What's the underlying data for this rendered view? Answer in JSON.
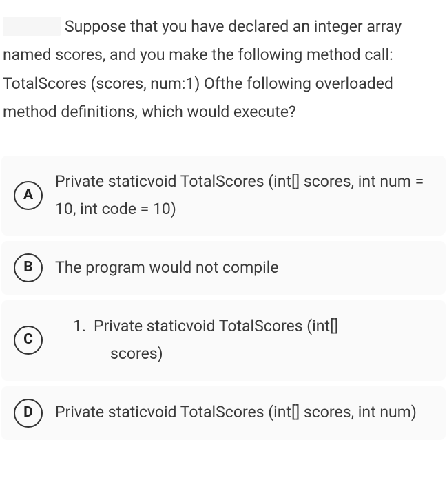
{
  "question": {
    "text": "Suppose that you have declared an integer array named scores, and you make the following method call: TotalScores (scores, num:1) Ofthe following overloaded method definitions, which would execute?"
  },
  "options": {
    "A": {
      "letter": "A",
      "text": "Private staticvoid TotalScores (int[] scores, int num = 10, int code = 10)"
    },
    "B": {
      "letter": "B",
      "text": "The program would not compile"
    },
    "C": {
      "letter": "C",
      "num": "1.",
      "line1": "Private staticvoid TotalScores (int[]",
      "line2": "scores)"
    },
    "D": {
      "letter": "D",
      "text": "Private staticvoid TotalScores (int[] scores, int num)"
    }
  }
}
